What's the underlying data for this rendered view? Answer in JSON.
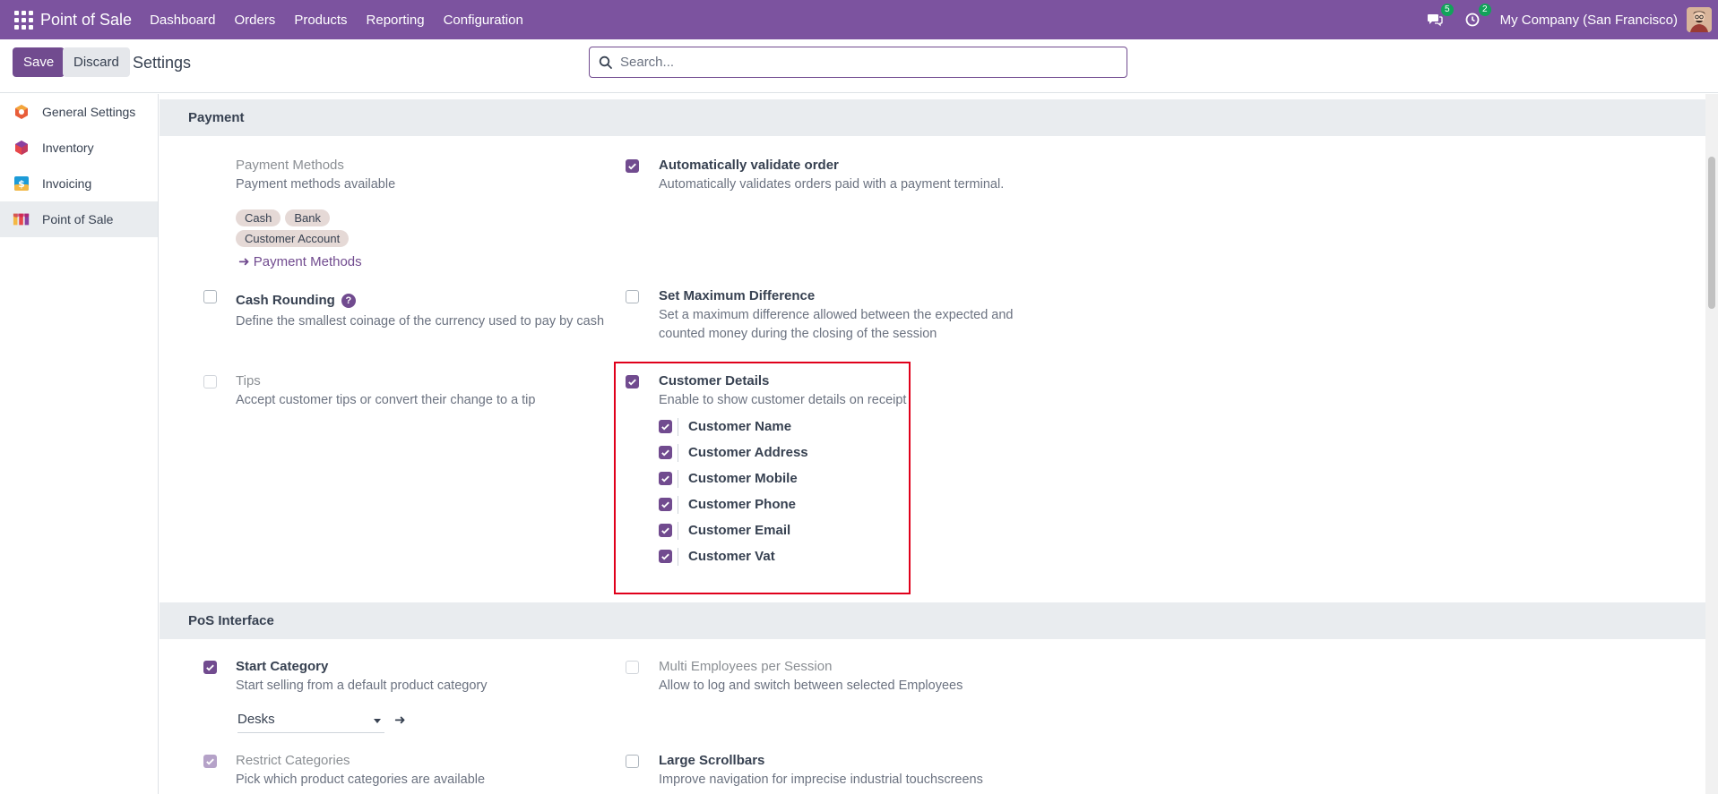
{
  "navbar": {
    "brand": "Point of Sale",
    "menu": [
      "Dashboard",
      "Orders",
      "Products",
      "Reporting",
      "Configuration"
    ],
    "messages_badge": "5",
    "activities_badge": "2",
    "company": "My Company (San Francisco)"
  },
  "control_panel": {
    "save_label": "Save",
    "discard_label": "Discard",
    "title": "Settings",
    "search_placeholder": "Search..."
  },
  "sidebar": {
    "items": [
      {
        "label": "General Settings",
        "icon": "general-settings-icon"
      },
      {
        "label": "Inventory",
        "icon": "inventory-icon"
      },
      {
        "label": "Invoicing",
        "icon": "invoicing-icon"
      },
      {
        "label": "Point of Sale",
        "icon": "point-of-sale-icon",
        "active": true
      }
    ]
  },
  "payment": {
    "heading": "Payment",
    "payment_methods": {
      "label": "Payment Methods",
      "desc": "Payment methods available",
      "tags": [
        "Cash",
        "Bank",
        "Customer Account"
      ],
      "link": "Payment Methods"
    },
    "auto_validate": {
      "label": "Automatically validate order",
      "desc": "Automatically validates orders paid with a payment terminal.",
      "checked": true
    },
    "cash_rounding": {
      "label": "Cash Rounding",
      "desc": "Define the smallest coinage of the currency used to pay by cash",
      "checked": false
    },
    "max_difference": {
      "label": "Set Maximum Difference",
      "desc1": "Set a maximum difference allowed between the expected and",
      "desc2": "counted money during the closing of the session",
      "checked": false
    },
    "tips": {
      "label": "Tips",
      "desc": "Accept customer tips or convert their change to a tip",
      "checked": false
    },
    "customer_details": {
      "label": "Customer Details",
      "desc": "Enable to show customer details on receipt",
      "checked": true,
      "options": [
        "Customer Name",
        "Customer Address",
        "Customer Mobile",
        "Customer Phone",
        "Customer Email",
        "Customer Vat"
      ]
    }
  },
  "pos_interface": {
    "heading": "PoS Interface",
    "start_category": {
      "label": "Start Category",
      "desc": "Start selling from a default product category",
      "checked": true,
      "value": "Desks"
    },
    "multi_employees": {
      "label": "Multi Employees per Session",
      "desc": "Allow to log and switch between selected Employees",
      "checked": false
    },
    "restrict_categories": {
      "label": "Restrict Categories",
      "desc": "Pick which product categories are available",
      "checked": true
    },
    "large_scrollbars": {
      "label": "Large Scrollbars",
      "desc": "Improve navigation for imprecise industrial touchscreens",
      "checked": false
    }
  },
  "colors": {
    "navbar": "#7c539f",
    "primary": "#714b8f",
    "highlight_border": "#e0001b"
  }
}
